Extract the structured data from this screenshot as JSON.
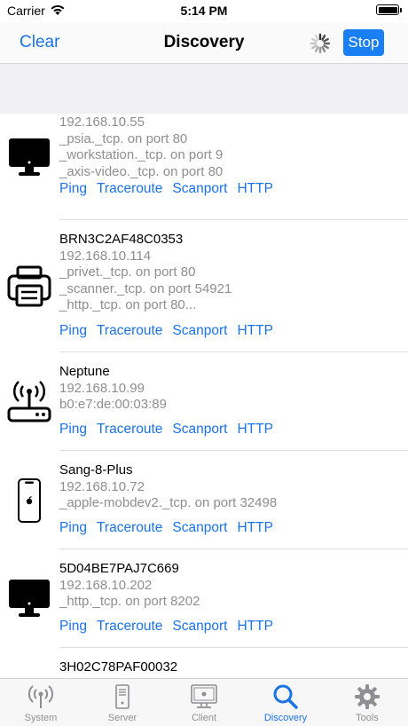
{
  "status_bar": {
    "carrier": "Carrier",
    "time": "5:14 PM"
  },
  "nav": {
    "clear_label": "Clear",
    "title": "Discovery",
    "stop_label": "Stop"
  },
  "accent_color": "#1a73e8",
  "devices": [
    {
      "icon": "desktop-icon",
      "lines": [
        "192.168.10.55",
        "_psia._tcp. on port 80",
        "_workstation._tcp. on port 9",
        "_axis-video._tcp. on port 80"
      ]
    },
    {
      "icon": "printer-icon",
      "name": "BRN3C2AF48C0353",
      "lines": [
        "192.168.10.114",
        "_privet._tcp. on port 80",
        "_scanner._tcp. on port 54921",
        "_http._tcp. on port 80..."
      ]
    },
    {
      "icon": "router-icon",
      "name": "Neptune",
      "lines": [
        "192.168.10.99",
        "b0:e7:de:00:03:89"
      ]
    },
    {
      "icon": "phone-icon",
      "name": "Sang-8-Plus",
      "lines": [
        "192.168.10.72",
        "_apple-mobdev2._tcp. on port 32498"
      ]
    },
    {
      "icon": "desktop-icon",
      "name": "5D04BE7PAJ7C669",
      "lines": [
        "192.168.10.202",
        "_http._tcp. on port 8202"
      ]
    },
    {
      "name": "3H02C78PAF00032"
    }
  ],
  "actions": [
    "Ping",
    "Traceroute",
    "Scanport",
    "HTTP"
  ],
  "tabs": [
    {
      "label": "System",
      "icon": "antenna-icon"
    },
    {
      "label": "Server",
      "icon": "server-icon"
    },
    {
      "label": "Client",
      "icon": "client-icon"
    },
    {
      "label": "Discovery",
      "icon": "search-icon",
      "active": true
    },
    {
      "label": "Tools",
      "icon": "gear-icon"
    }
  ]
}
